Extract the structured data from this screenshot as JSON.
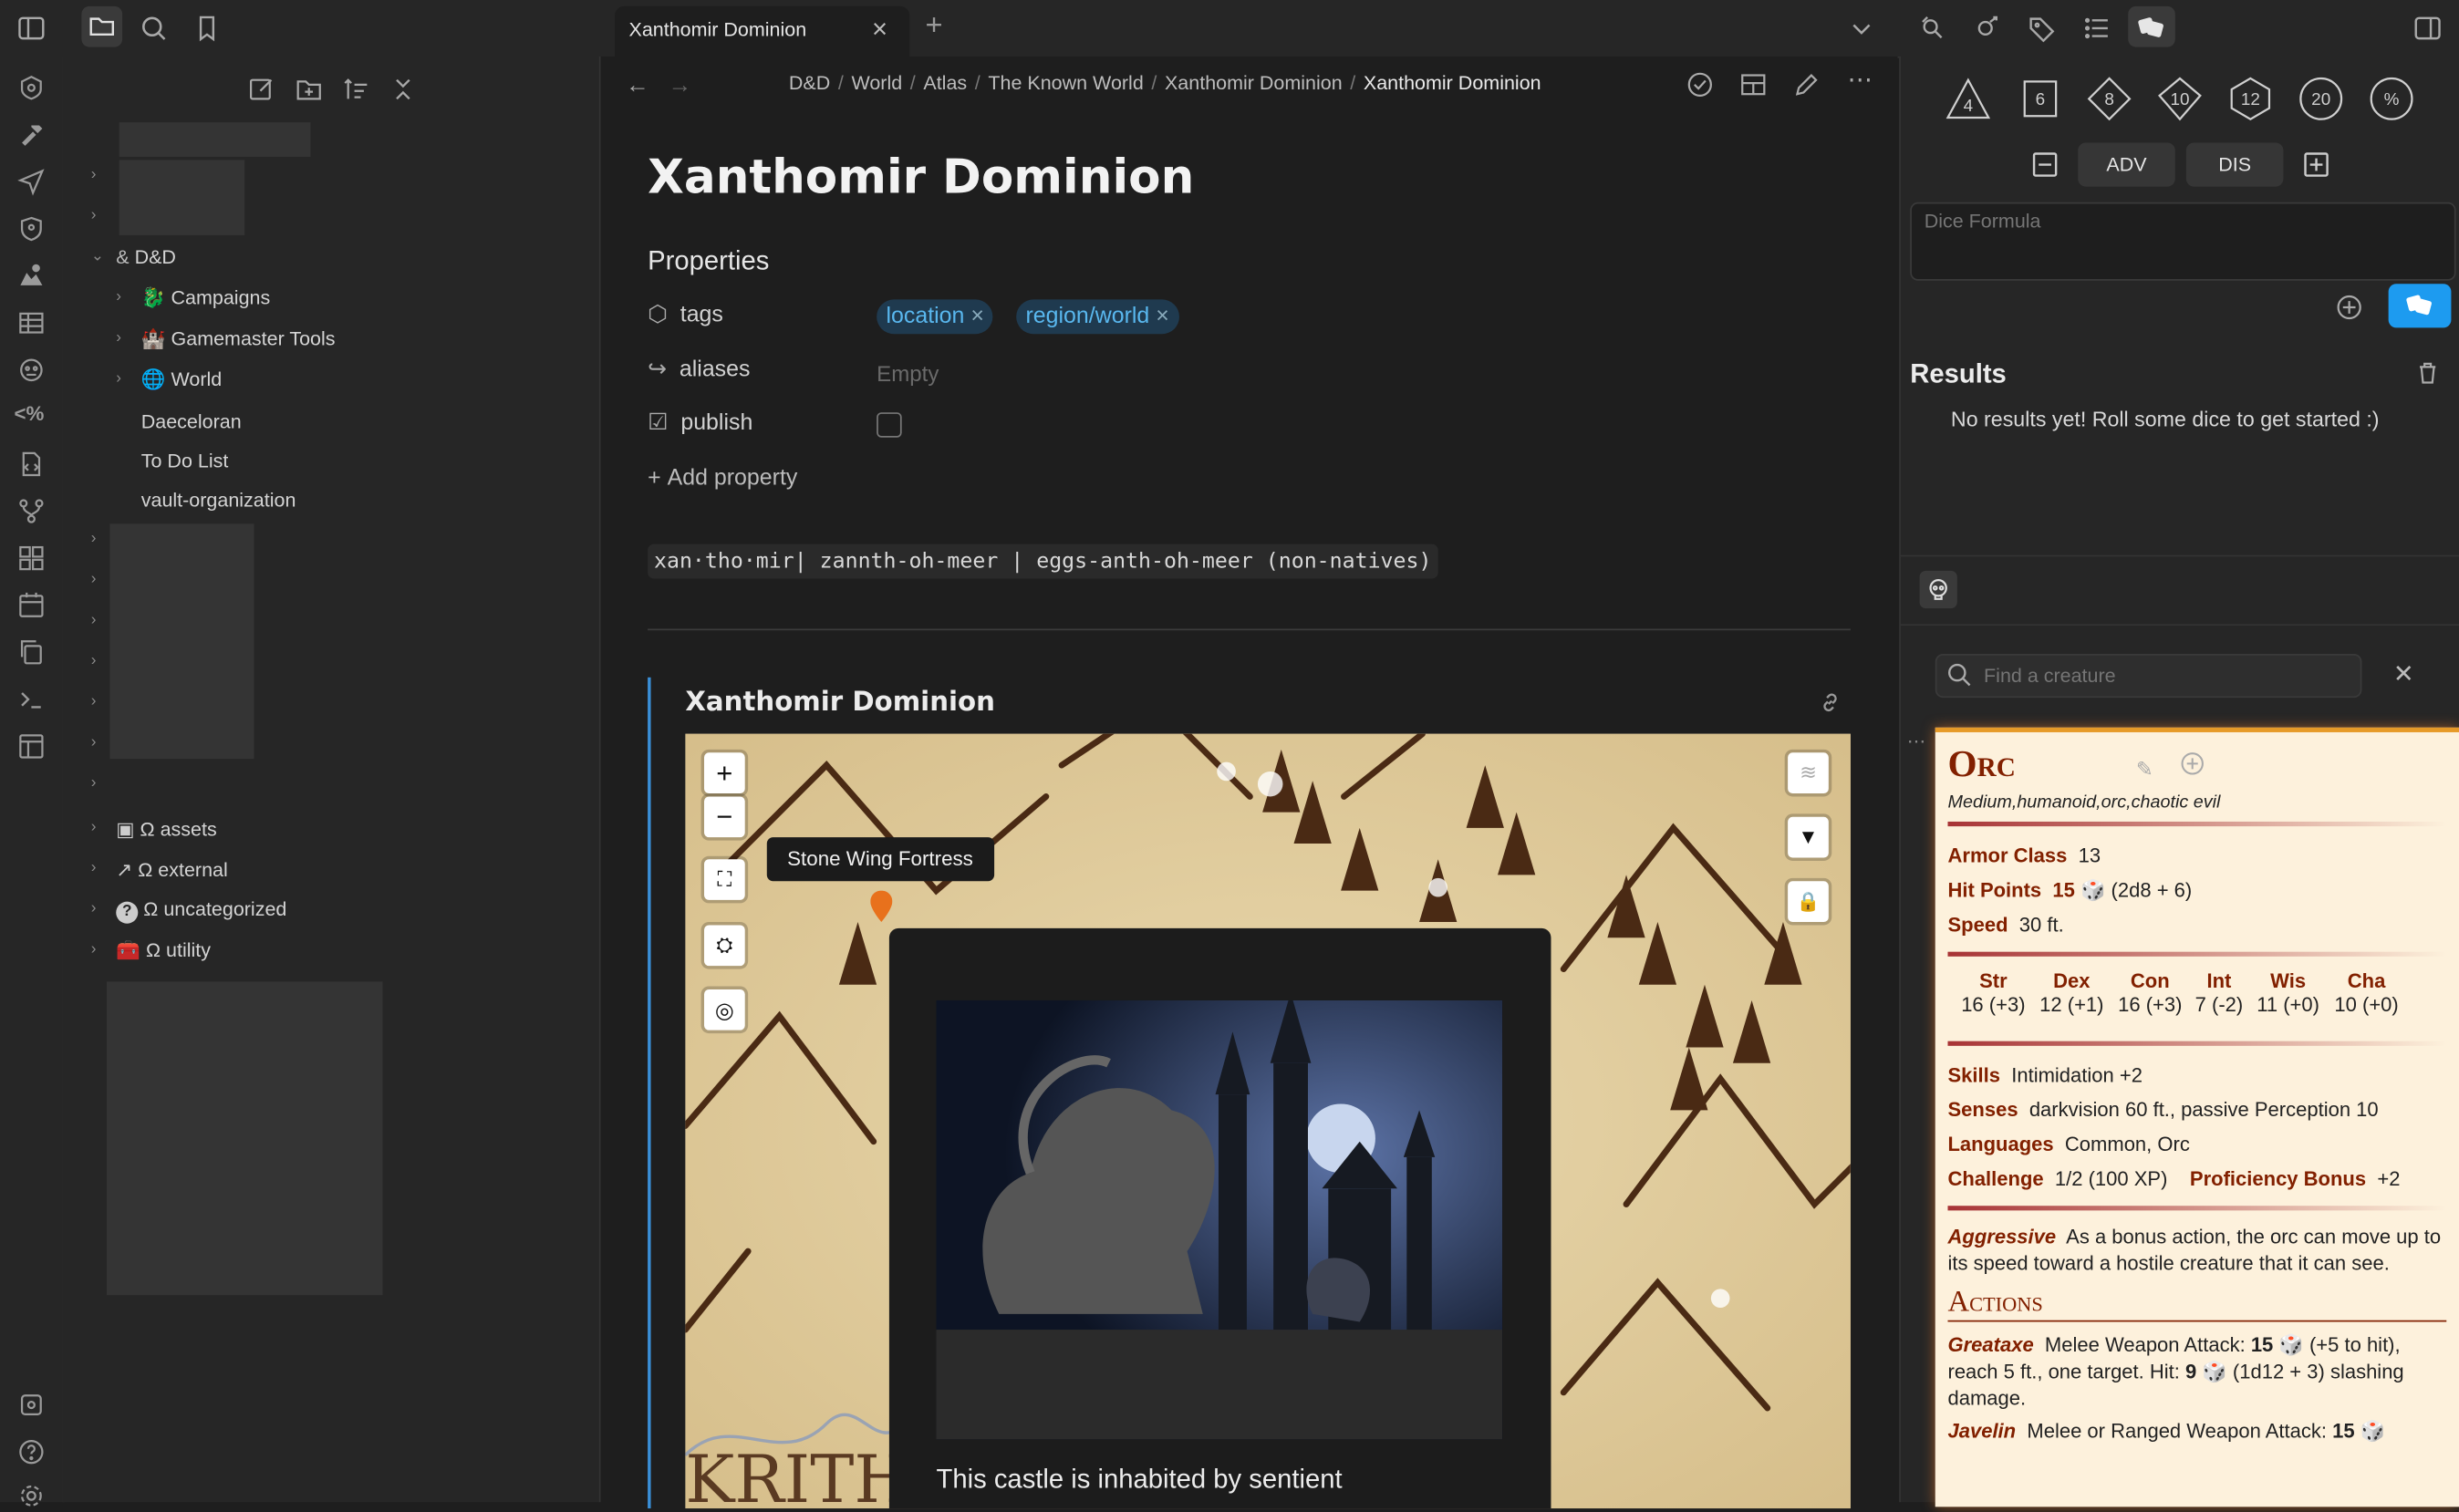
{
  "tabbar": {
    "tab_title": "Xanthomir Dominion",
    "close": "×",
    "new_tab": "+"
  },
  "breadcrumb": [
    "D&D",
    "World",
    "Atlas",
    "The Known World",
    "Xanthomir Dominion",
    "Xanthomir Dominion"
  ],
  "breadcrumb_sep": "/",
  "sidebar": {
    "items": [
      {
        "label": "D&D"
      },
      {
        "label": "Campaigns"
      },
      {
        "label": "Gamemaster Tools"
      },
      {
        "label": "World"
      },
      {
        "label": "Daeceloran"
      },
      {
        "label": "To Do List"
      },
      {
        "label": "vault-organization"
      },
      {
        "label": "Ω assets"
      },
      {
        "label": "Ω external"
      },
      {
        "label": "Ω uncategorized"
      },
      {
        "label": "Ω utility"
      }
    ]
  },
  "note": {
    "title": "Xanthomir Dominion",
    "properties_heading": "Properties",
    "props": {
      "tags_label": "tags",
      "tags": [
        "location",
        "region/world"
      ],
      "aliases_label": "aliases",
      "aliases_value": "Empty",
      "publish_label": "publish",
      "add_property": "Add property"
    },
    "pronunciation": "xan·tho·mir| zannth-oh-meer | eggs-anth-oh-meer (non-natives)",
    "map_title": "Xanthomir Dominion",
    "map_tooltip": "Stone Wing Fortress",
    "map_popup_text": "This castle is inhabited by sentient",
    "map_label": "KRITH"
  },
  "dice": {
    "dice": [
      "4",
      "6",
      "8",
      "10",
      "12",
      "20",
      "%"
    ],
    "adv": "ADV",
    "dis": "DIS",
    "formula_placeholder": "Dice Formula",
    "results_heading": "Results",
    "no_results": "No results yet! Roll some dice to get started :)"
  },
  "bestiary": {
    "search_placeholder": "Find a creature",
    "name": "Orc",
    "meta": "Medium,humanoid,orc,chaotic evil",
    "armor_class_label": "Armor Class",
    "armor_class": "13",
    "hit_points_label": "Hit Points",
    "hit_points": "15",
    "hit_dice": "(2d8 + 6)",
    "speed_label": "Speed",
    "speed": "30 ft.",
    "abilities": [
      {
        "name": "Str",
        "value": "16 (+3)"
      },
      {
        "name": "Dex",
        "value": "12 (+1)"
      },
      {
        "name": "Con",
        "value": "16 (+3)"
      },
      {
        "name": "Int",
        "value": "7 (-2)"
      },
      {
        "name": "Wis",
        "value": "11 (+0)"
      },
      {
        "name": "Cha",
        "value": "10 (+0)"
      }
    ],
    "skills_label": "Skills",
    "skills": "Intimidation +2",
    "senses_label": "Senses",
    "senses": "darkvision 60 ft., passive Perception 10",
    "languages_label": "Languages",
    "languages": "Common, Orc",
    "challenge_label": "Challenge",
    "challenge": "1/2 (100 XP)",
    "prof_label": "Proficiency Bonus",
    "prof": "+2",
    "trait_name": "Aggressive",
    "trait_text": "As a bonus action, the orc can move up to its speed toward a hostile creature that it can see.",
    "actions_heading": "Actions",
    "action1_name": "Greataxe",
    "action1_a": "Melee Weapon Attack:",
    "action1_b": "15",
    "action1_c": "(+5 to hit), reach 5 ft., one target. Hit:",
    "action1_d": "9",
    "action1_e": "(1d12 + 3) slashing damage.",
    "action2_name": "Javelin",
    "action2_a": "Melee or Ranged Weapon Attack:",
    "action2_b": "15"
  },
  "colors": {
    "accent": "#3a8fd8",
    "tag_text": "#59b7ee",
    "stat_red": "#822000",
    "roll_button": "#1d9bf0"
  }
}
